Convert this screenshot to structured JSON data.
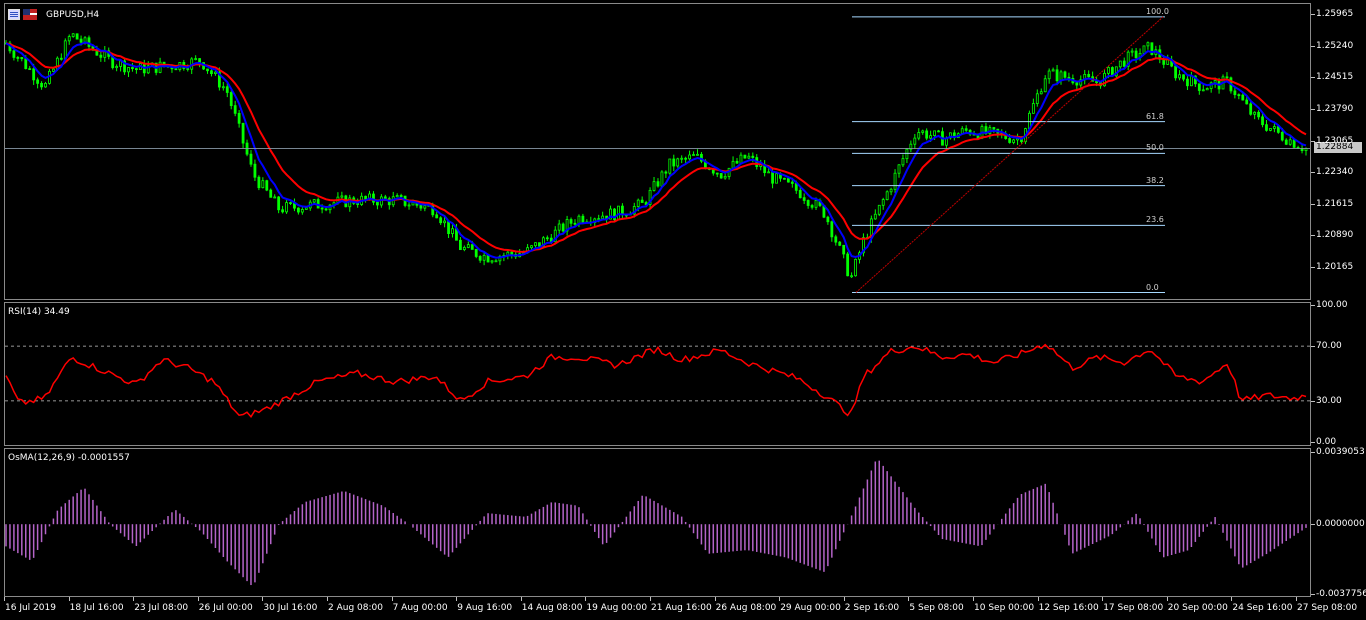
{
  "chart_header": {
    "symbol_title": "GBPUSD,H4",
    "icons": [
      "chart-window-icon",
      "flag-icon"
    ]
  },
  "current_price": "1.22884",
  "colors": {
    "candle": "#00ff00",
    "ma_fast": "#0000ff",
    "ma_slow": "#ff0000",
    "fib": "#a6d8ff",
    "rsi": "#ff0000",
    "osma": "#b464c8",
    "background": "#000000"
  },
  "price_panel": {
    "price_ticks": [
      "1.25965",
      "1.25240",
      "1.24515",
      "1.23790",
      "1.23065",
      "1.22340",
      "1.21615",
      "1.20890",
      "1.20165"
    ],
    "fib_levels": [
      {
        "label": "100.0",
        "price": 1.259
      },
      {
        "label": "61.8",
        "price": 1.235
      },
      {
        "label": "50.0",
        "price": 1.2277
      },
      {
        "label": "38.2",
        "price": 1.2203
      },
      {
        "label": "23.6",
        "price": 1.2112
      },
      {
        "label": "0.0",
        "price": 1.1958
      }
    ]
  },
  "rsi_panel": {
    "title": "RSI(14) 34.49",
    "ticks": [
      "100.00",
      "70.00",
      "30.00",
      "0.00"
    ],
    "levels": [
      70,
      30
    ]
  },
  "osma_panel": {
    "title": "OsMA(12,26,9) -0.0001557",
    "ticks": [
      "0.0039053",
      "0.0000000",
      "-0.0037756"
    ]
  },
  "time_axis": [
    "16 Jul 2019",
    "18 Jul 16:00",
    "23 Jul 08:00",
    "26 Jul 00:00",
    "30 Jul 16:00",
    "2 Aug 08:00",
    "7 Aug 00:00",
    "9 Aug 16:00",
    "14 Aug 08:00",
    "19 Aug 00:00",
    "21 Aug 16:00",
    "26 Aug 08:00",
    "29 Aug 00:00",
    "2 Sep 16:00",
    "5 Sep 08:00",
    "10 Sep 00:00",
    "12 Sep 16:00",
    "17 Sep 08:00",
    "20 Sep 00:00",
    "24 Sep 16:00",
    "27 Sep 08:00"
  ],
  "chart_data": {
    "type": "line",
    "symbol": "GBPUSD",
    "timeframe": "H4",
    "price_keypoints": [
      [
        0,
        1.253
      ],
      [
        0.03,
        1.243
      ],
      [
        0.05,
        1.255
      ],
      [
        0.08,
        1.249
      ],
      [
        0.1,
        1.247
      ],
      [
        0.13,
        1.248
      ],
      [
        0.15,
        1.249
      ],
      [
        0.17,
        1.242
      ],
      [
        0.19,
        1.223
      ],
      [
        0.21,
        1.215
      ],
      [
        0.24,
        1.216
      ],
      [
        0.27,
        1.217
      ],
      [
        0.3,
        1.217
      ],
      [
        0.33,
        1.215
      ],
      [
        0.35,
        1.206
      ],
      [
        0.37,
        1.204
      ],
      [
        0.4,
        1.205
      ],
      [
        0.42,
        1.209
      ],
      [
        0.44,
        1.213
      ],
      [
        0.47,
        1.214
      ],
      [
        0.49,
        1.216
      ],
      [
        0.51,
        1.225
      ],
      [
        0.53,
        1.227
      ],
      [
        0.55,
        1.223
      ],
      [
        0.57,
        1.227
      ],
      [
        0.59,
        1.222
      ],
      [
        0.61,
        1.219
      ],
      [
        0.63,
        1.214
      ],
      [
        0.65,
        1.199
      ],
      [
        0.66,
        1.208
      ],
      [
        0.68,
        1.22
      ],
      [
        0.7,
        1.233
      ],
      [
        0.72,
        1.231
      ],
      [
        0.74,
        1.233
      ],
      [
        0.76,
        1.232
      ],
      [
        0.78,
        1.231
      ],
      [
        0.8,
        1.246
      ],
      [
        0.82,
        1.245
      ],
      [
        0.84,
        1.244
      ],
      [
        0.86,
        1.249
      ],
      [
        0.88,
        1.252
      ],
      [
        0.9,
        1.246
      ],
      [
        0.92,
        1.243
      ],
      [
        0.94,
        1.244
      ],
      [
        0.96,
        1.236
      ],
      [
        0.98,
        1.232
      ],
      [
        1.0,
        1.2288
      ]
    ],
    "rsi_keypoints": [
      [
        0,
        48
      ],
      [
        0.01,
        28
      ],
      [
        0.03,
        32
      ],
      [
        0.05,
        62
      ],
      [
        0.08,
        50
      ],
      [
        0.1,
        42
      ],
      [
        0.12,
        60
      ],
      [
        0.14,
        54
      ],
      [
        0.16,
        44
      ],
      [
        0.18,
        18
      ],
      [
        0.2,
        24
      ],
      [
        0.22,
        34
      ],
      [
        0.24,
        44
      ],
      [
        0.27,
        50
      ],
      [
        0.3,
        44
      ],
      [
        0.33,
        48
      ],
      [
        0.35,
        30
      ],
      [
        0.37,
        44
      ],
      [
        0.4,
        48
      ],
      [
        0.42,
        62
      ],
      [
        0.44,
        62
      ],
      [
        0.47,
        56
      ],
      [
        0.5,
        68
      ],
      [
        0.52,
        60
      ],
      [
        0.55,
        67
      ],
      [
        0.57,
        58
      ],
      [
        0.59,
        52
      ],
      [
        0.61,
        46
      ],
      [
        0.63,
        34
      ],
      [
        0.65,
        20
      ],
      [
        0.66,
        48
      ],
      [
        0.68,
        66
      ],
      [
        0.7,
        70
      ],
      [
        0.72,
        62
      ],
      [
        0.74,
        64
      ],
      [
        0.76,
        58
      ],
      [
        0.78,
        64
      ],
      [
        0.8,
        72
      ],
      [
        0.82,
        54
      ],
      [
        0.84,
        62
      ],
      [
        0.86,
        58
      ],
      [
        0.88,
        68
      ],
      [
        0.9,
        48
      ],
      [
        0.92,
        44
      ],
      [
        0.94,
        58
      ],
      [
        0.95,
        30
      ],
      [
        0.97,
        34
      ],
      [
        0.99,
        32
      ],
      [
        1.0,
        34
      ]
    ],
    "osma_keypoints": [
      [
        0,
        -0.0012
      ],
      [
        0.02,
        -0.002
      ],
      [
        0.04,
        0.0008
      ],
      [
        0.06,
        0.002
      ],
      [
        0.08,
        0.0
      ],
      [
        0.1,
        -0.0012
      ],
      [
        0.13,
        0.0008
      ],
      [
        0.15,
        -0.0004
      ],
      [
        0.17,
        -0.002
      ],
      [
        0.19,
        -0.0034
      ],
      [
        0.21,
        0.0
      ],
      [
        0.23,
        0.0012
      ],
      [
        0.26,
        0.0018
      ],
      [
        0.29,
        0.001
      ],
      [
        0.31,
        0.0
      ],
      [
        0.34,
        -0.0018
      ],
      [
        0.37,
        0.0006
      ],
      [
        0.4,
        0.0004
      ],
      [
        0.42,
        0.0012
      ],
      [
        0.44,
        0.001
      ],
      [
        0.46,
        -0.0012
      ],
      [
        0.49,
        0.0016
      ],
      [
        0.52,
        0.0004
      ],
      [
        0.54,
        -0.0016
      ],
      [
        0.57,
        -0.0014
      ],
      [
        0.6,
        -0.0018
      ],
      [
        0.63,
        -0.0026
      ],
      [
        0.65,
        0.0004
      ],
      [
        0.67,
        0.0036
      ],
      [
        0.7,
        0.0008
      ],
      [
        0.72,
        -0.0008
      ],
      [
        0.75,
        -0.0012
      ],
      [
        0.78,
        0.0016
      ],
      [
        0.8,
        0.0022
      ],
      [
        0.82,
        -0.0016
      ],
      [
        0.85,
        -0.0006
      ],
      [
        0.87,
        0.0006
      ],
      [
        0.89,
        -0.0018
      ],
      [
        0.91,
        -0.0014
      ],
      [
        0.93,
        0.0004
      ],
      [
        0.95,
        -0.0024
      ],
      [
        0.97,
        -0.0016
      ],
      [
        1.0,
        -0.0002
      ]
    ],
    "price_range": [
      1.195,
      1.2615
    ],
    "rsi_range": [
      0,
      100
    ],
    "osma_range": [
      -0.0037756,
      0.0039053
    ]
  }
}
